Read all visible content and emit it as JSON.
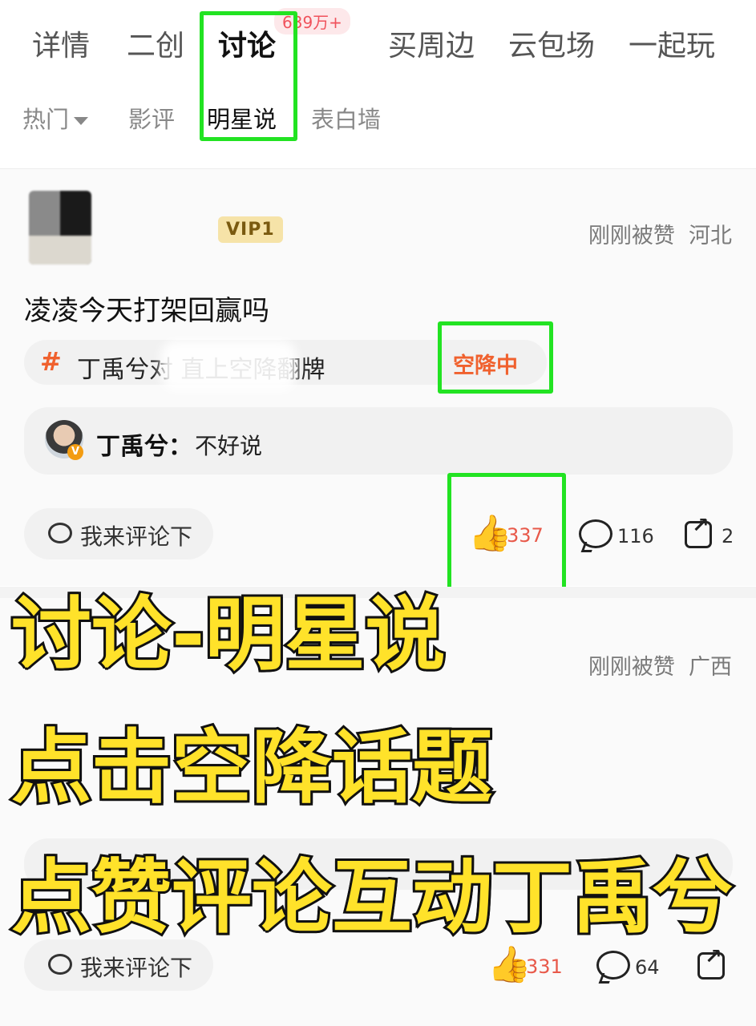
{
  "tabs": [
    {
      "label": "详情",
      "active": false
    },
    {
      "label": "二创",
      "active": false
    },
    {
      "label": "讨论",
      "active": true
    },
    {
      "label": "买周边",
      "active": false
    },
    {
      "label": "云包场",
      "active": false
    },
    {
      "label": "一起玩",
      "active": false
    }
  ],
  "discussion_count": "639万+",
  "subtabs": [
    {
      "label": "热门",
      "active": false
    },
    {
      "label": "影评",
      "active": false
    },
    {
      "label": "明星说",
      "active": true
    },
    {
      "label": "表白墙",
      "active": false
    }
  ],
  "post1": {
    "vip": "VIP1",
    "liked_status": "刚刚被赞",
    "location": "河北",
    "title": "凌凌今天打架回赢吗",
    "topic_hash": "#",
    "topic_text": "丁禹兮对            直上空降翻牌",
    "topic_badge": "空降中",
    "reply_name": "丁禹兮",
    "reply_sep": "：",
    "reply_text": "不好说",
    "comment_btn": "我来评论下",
    "likes": "337",
    "comments": "116",
    "shares": "2"
  },
  "post2": {
    "liked_status": "刚刚被赞",
    "location": "广西",
    "comment_btn": "我来评论下",
    "likes": "331",
    "comments": "64"
  },
  "overlay": {
    "line1": "讨论-明星说",
    "line2": "点击空降话题",
    "line3": "点赞评论互动丁禹兮"
  },
  "colors": {
    "highlight_box": "#22e322",
    "overlay_text": "#ffe22a",
    "accent_orange": "#f0612e",
    "like_red": "#e8594a"
  }
}
